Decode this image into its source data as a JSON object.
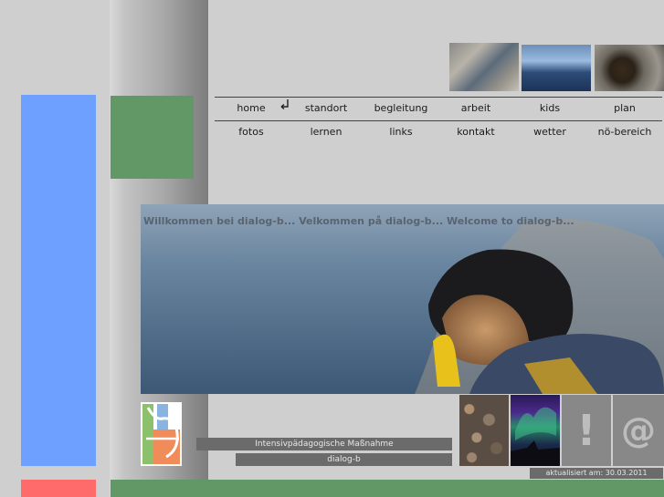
{
  "nav": {
    "row1": [
      "home",
      "standort",
      "begleitung",
      "arbeit",
      "kids",
      "plan"
    ],
    "row2": [
      "fotos",
      "lernen",
      "links",
      "kontakt",
      "wetter",
      "nö-bereich"
    ]
  },
  "hero": {
    "welcome": "Willkommen bei dialog-b... Velkommen på dialog-b... Welcome to dialog-b..."
  },
  "labels": {
    "subtitle": "Intensivpädagogische Maßnahme",
    "brand": "dialog-b"
  },
  "tiles": {
    "exclamation": "!",
    "at": "@"
  },
  "footer": {
    "updated": "aktualisiert am: 30.03.2011"
  },
  "colors": {
    "blue_bar": "#6ea0ff",
    "green_box": "#619866",
    "red_bar": "#ff6b6b",
    "label_bg": "#6b6b6b"
  },
  "icons": {
    "current_page": "return-arrow-icon"
  }
}
